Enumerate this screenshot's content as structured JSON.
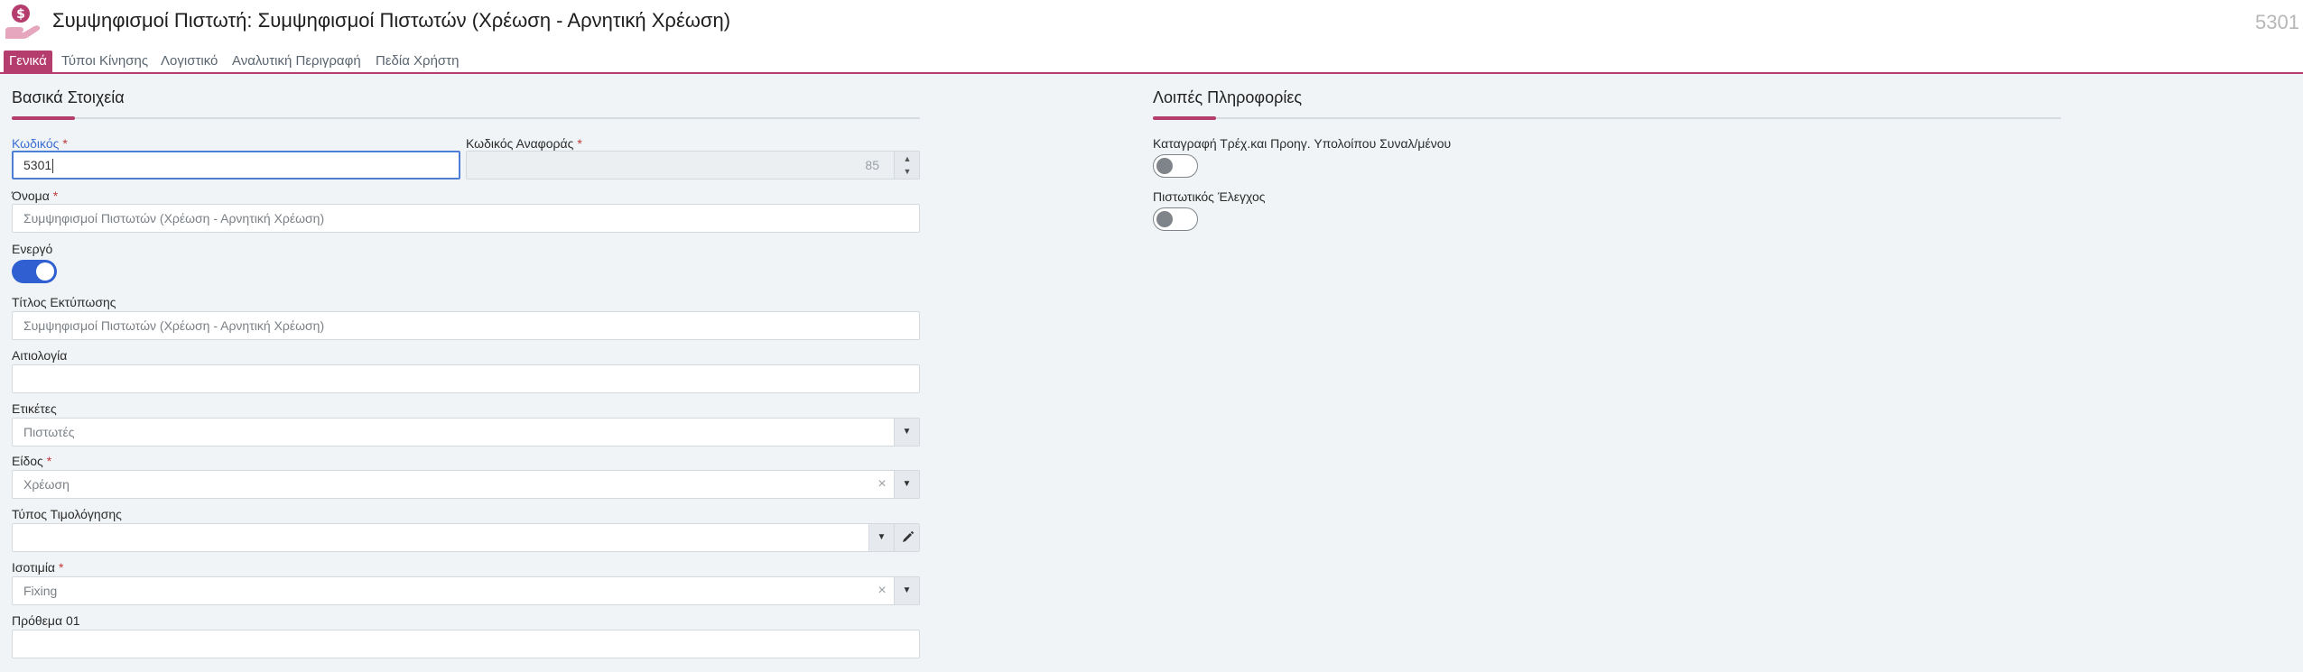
{
  "header": {
    "title": "Συμψηφισμοί Πιστωτή: Συμψηφισμοί Πιστωτών (Χρέωση - Αρνητική Χρέωση)",
    "record_id": "5301",
    "icon": "money-hand-icon"
  },
  "tabs": [
    {
      "label": "Γενικά",
      "active": true
    },
    {
      "label": "Τύποι Κίνησης",
      "active": false
    },
    {
      "label": "Λογιστικό",
      "active": false
    },
    {
      "label": "Αναλυτική Περιγραφή",
      "active": false
    },
    {
      "label": "Πεδία Χρήστη",
      "active": false
    }
  ],
  "basic": {
    "section_title": "Βασικά Στοιχεία",
    "code": {
      "label": "Κωδικός",
      "value": "5301"
    },
    "ref_code": {
      "label": "Κωδικός Αναφοράς",
      "value": "85"
    },
    "name": {
      "label": "Όνομα",
      "value": "Συμψηφισμοί Πιστωτών (Χρέωση - Αρνητική Χρέωση)"
    },
    "active": {
      "label": "Ενεργό",
      "on": true
    },
    "print_title": {
      "label": "Τίτλος Εκτύπωσης",
      "value": "Συμψηφισμοί Πιστωτών (Χρέωση - Αρνητική Χρέωση)"
    },
    "reason": {
      "label": "Αιτιολογία",
      "value": ""
    },
    "tags": {
      "label": "Ετικέτες",
      "value": "Πιστωτές"
    },
    "kind": {
      "label": "Είδος",
      "value": "Χρέωση"
    },
    "pricing_type": {
      "label": "Τύπος Τιμολόγησης",
      "value": ""
    },
    "parity": {
      "label": "Ισοτιμία",
      "value": "Fixing"
    },
    "prefix": {
      "label": "Πρόθεμα 01",
      "value": ""
    }
  },
  "other": {
    "section_title": "Λοιπές Πληροφορίες",
    "balance_record": {
      "label": "Καταγραφή Τρέχ.και Προηγ. Υπολοίπου Συναλ/μένου",
      "on": false
    },
    "credit_check": {
      "label": "Πιστωτικός Έλεγχος",
      "on": false
    }
  },
  "colors": {
    "accent": "#b53d6e",
    "toggle_on": "#2f5fd0",
    "focus": "#4d7fd8",
    "required": "#c0393b"
  }
}
